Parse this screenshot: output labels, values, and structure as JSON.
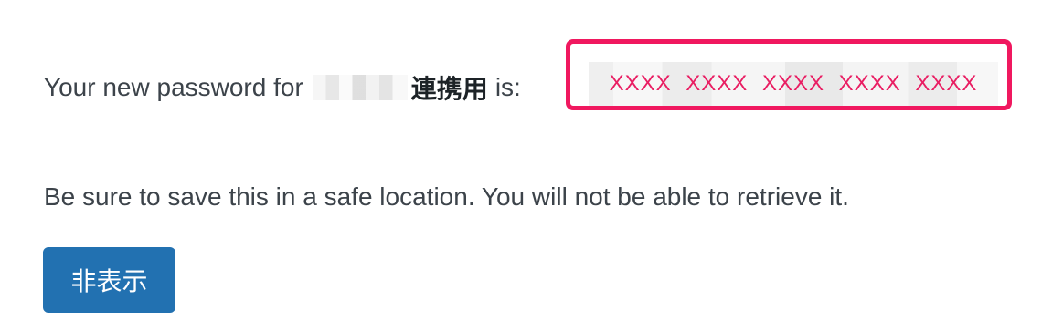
{
  "message": {
    "prefix": "Your new password for",
    "app_name": "連携用",
    "suffix": "is:",
    "password": "XXXX XXXX XXXX XXXX XXXX"
  },
  "warning": "Be sure to save this in a safe location. You will not be able to retrieve it.",
  "dismiss_button": {
    "label": "非表示",
    "color": "#2271b1"
  },
  "colors": {
    "highlight_border": "#f0185f",
    "password_text": "#e91e63"
  }
}
